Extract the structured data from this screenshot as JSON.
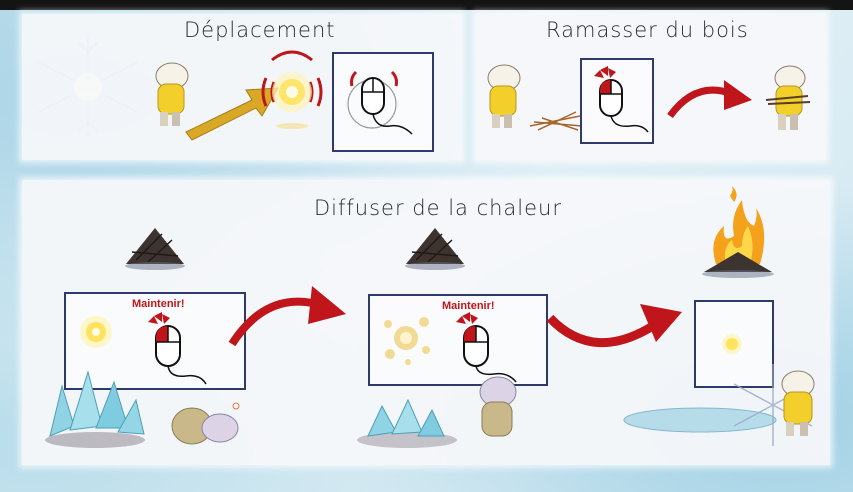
{
  "sections": {
    "move": {
      "title": "Déplacement"
    },
    "wood": {
      "title": "Ramasser du bois"
    },
    "heat": {
      "title": "Diffuser de la chaleur",
      "hold_label_1": "Maintenir!",
      "hold_label_2": "Maintenir!"
    }
  },
  "icons": {
    "mouse": "mouse-icon",
    "arrow": "curved-arrow-icon",
    "light": "light-orb-icon",
    "character": "yellow-hooded-character",
    "fire": "campfire-icon",
    "ice": "ice-crystal-icon",
    "snowflake": "snowflake-icon"
  },
  "colors": {
    "accent_red": "#c0151b",
    "arrow_gold": "#d8a826",
    "coat_yellow": "#f2cf2a",
    "ice_blue": "#7fcbe0",
    "screen_border": "#2e3a6a"
  }
}
